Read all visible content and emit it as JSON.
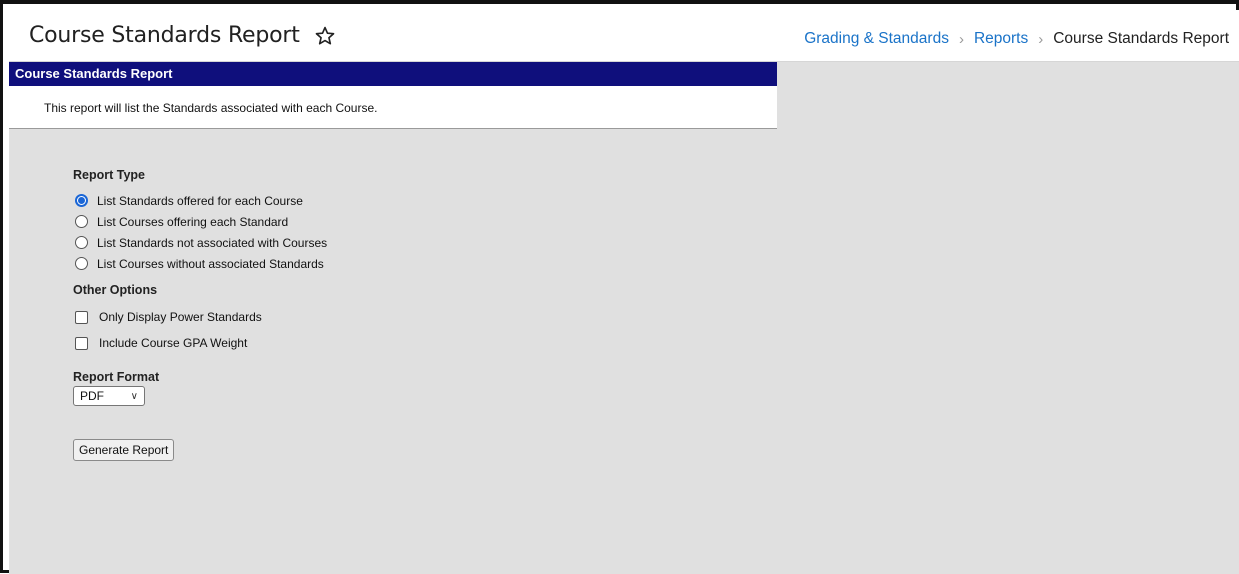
{
  "header": {
    "title": "Course Standards Report",
    "star_icon": "star-outline-icon",
    "breadcrumb": [
      {
        "label": "Grading & Standards",
        "link": true
      },
      {
        "label": "Reports",
        "link": true
      },
      {
        "label": "Course Standards Report",
        "link": false
      }
    ]
  },
  "panel": {
    "title": "Course Standards Report",
    "description": "This report will list the Standards associated with each Course."
  },
  "form": {
    "report_type_label": "Report Type",
    "report_types": [
      {
        "label": "List Standards offered for each Course",
        "selected": true
      },
      {
        "label": "List Courses offering each Standard",
        "selected": false
      },
      {
        "label": "List Standards not associated with Courses",
        "selected": false
      },
      {
        "label": "List Courses without associated Standards",
        "selected": false
      }
    ],
    "other_options_label": "Other Options",
    "other_options": [
      {
        "label": "Only Display Power Standards",
        "checked": false
      },
      {
        "label": "Include Course GPA Weight",
        "checked": false
      }
    ],
    "report_format_label": "Report Format",
    "report_format_value": "PDF",
    "generate_button": "Generate Report"
  },
  "colors": {
    "panel_header_bg": "#0f0f7c",
    "link": "#1a73c8",
    "radio_selected": "#1a66d6",
    "content_bg": "#e0e0e0"
  }
}
